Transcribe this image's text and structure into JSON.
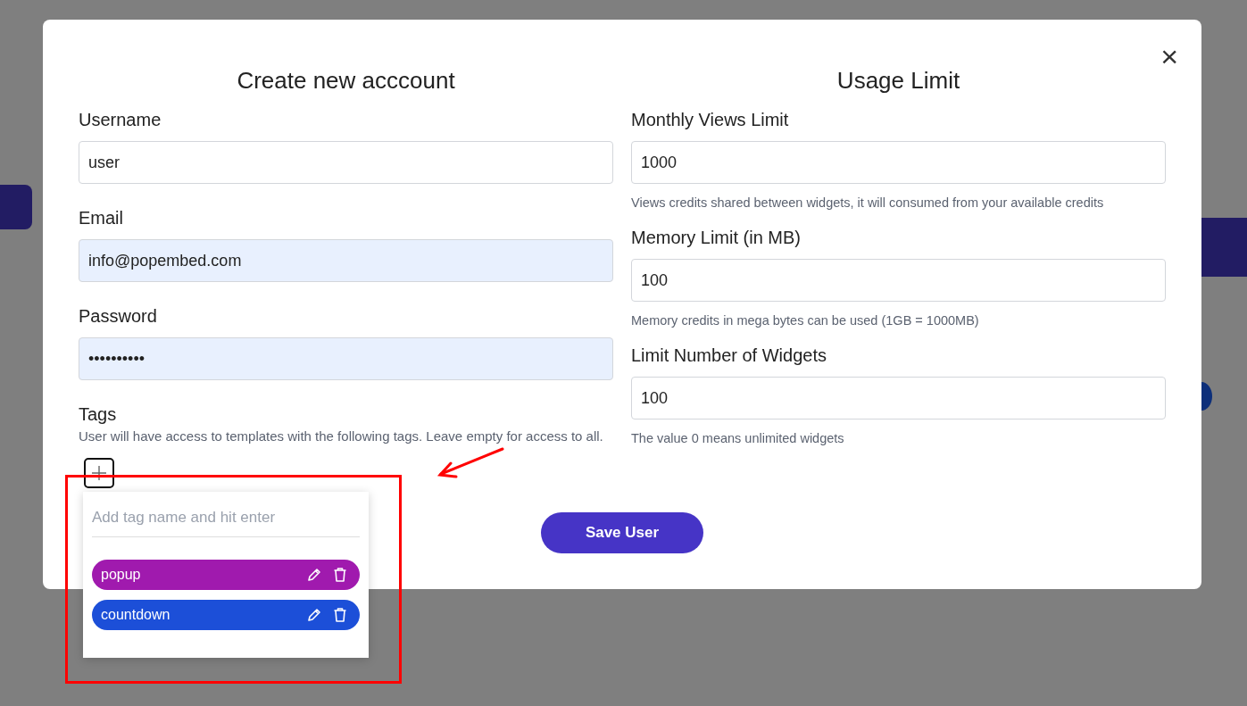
{
  "modal": {
    "close_label": "×",
    "left": {
      "title": "Create new acccount",
      "fields": [
        {
          "label": "Username",
          "value": "user",
          "autofilled": false
        },
        {
          "label": "Email",
          "value": "info@popembed.com",
          "autofilled": true
        },
        {
          "label": "Password",
          "value": "••••••••••",
          "autofilled": true
        }
      ],
      "tags": {
        "label": "Tags",
        "help": "User will have access to templates with the following tags. Leave empty for access to all.",
        "expanded": true,
        "dropdown": {
          "placeholder": "Add tag name and hit enter",
          "items": [
            {
              "name": "popup",
              "color": "#a01aae"
            },
            {
              "name": "countdown",
              "color": "#1c4fd8"
            }
          ]
        }
      }
    },
    "right": {
      "title": "Usage Limit",
      "fields": [
        {
          "label": "Monthly Views Limit",
          "value": "1000",
          "help": "Views credits shared between widgets, it will consumed from your available credits"
        },
        {
          "label": "Memory Limit (in MB)",
          "value": "100",
          "help": "Memory credits in mega bytes can be used (1GB = 1000MB)"
        },
        {
          "label": "Limit Number of Widgets",
          "value": "100",
          "help": "The value 0 means unlimited widgets"
        }
      ]
    },
    "save_button": "Save User"
  }
}
